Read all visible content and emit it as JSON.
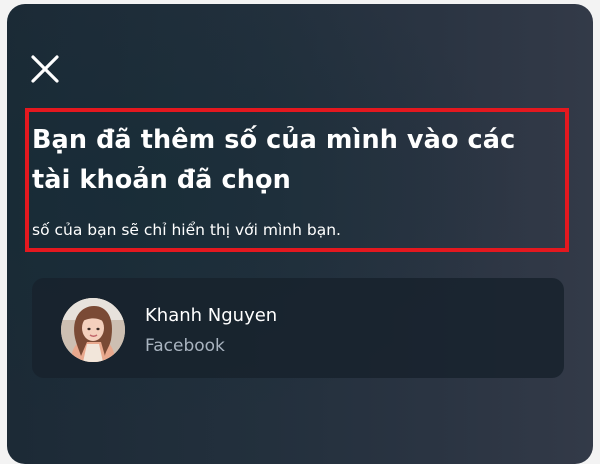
{
  "dialog": {
    "close_icon": "close-icon",
    "title": "Bạn đã thêm số của mình vào các tài khoản đã chọn",
    "subtitle": "số của bạn sẽ chỉ hiển thị với mình bạn."
  },
  "account": {
    "name": "Khanh Nguyen",
    "platform": "Facebook",
    "avatar_icon": "avatar"
  },
  "colors": {
    "highlight": "#e4181f",
    "background": "#23303d",
    "card": "#18222d",
    "text": "#ffffff",
    "secondary_text": "#a9b4c0"
  }
}
